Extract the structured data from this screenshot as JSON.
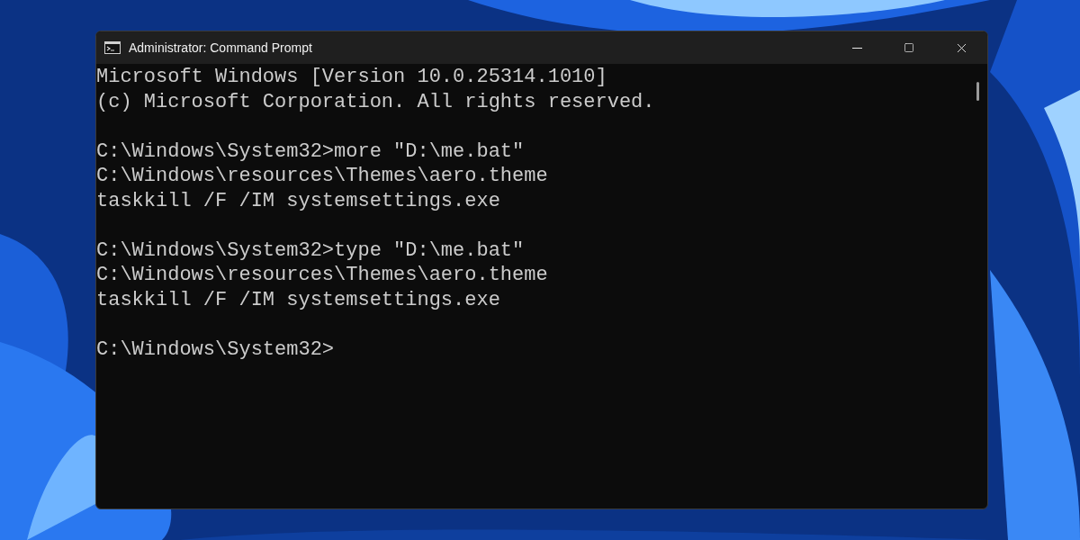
{
  "window": {
    "title": "Administrator: Command Prompt"
  },
  "console": {
    "blocks": [
      [
        "Microsoft Windows [Version 10.0.25314.1010]",
        "(c) Microsoft Corporation. All rights reserved."
      ],
      [
        "C:\\Windows\\System32>more \"D:\\me.bat\"",
        "C:\\Windows\\resources\\Themes\\aero.theme",
        "taskkill /F /IM systemsettings.exe"
      ],
      [
        "C:\\Windows\\System32>type \"D:\\me.bat\"",
        "C:\\Windows\\resources\\Themes\\aero.theme",
        "taskkill /F /IM systemsettings.exe"
      ],
      [
        "C:\\Windows\\System32>"
      ]
    ]
  }
}
